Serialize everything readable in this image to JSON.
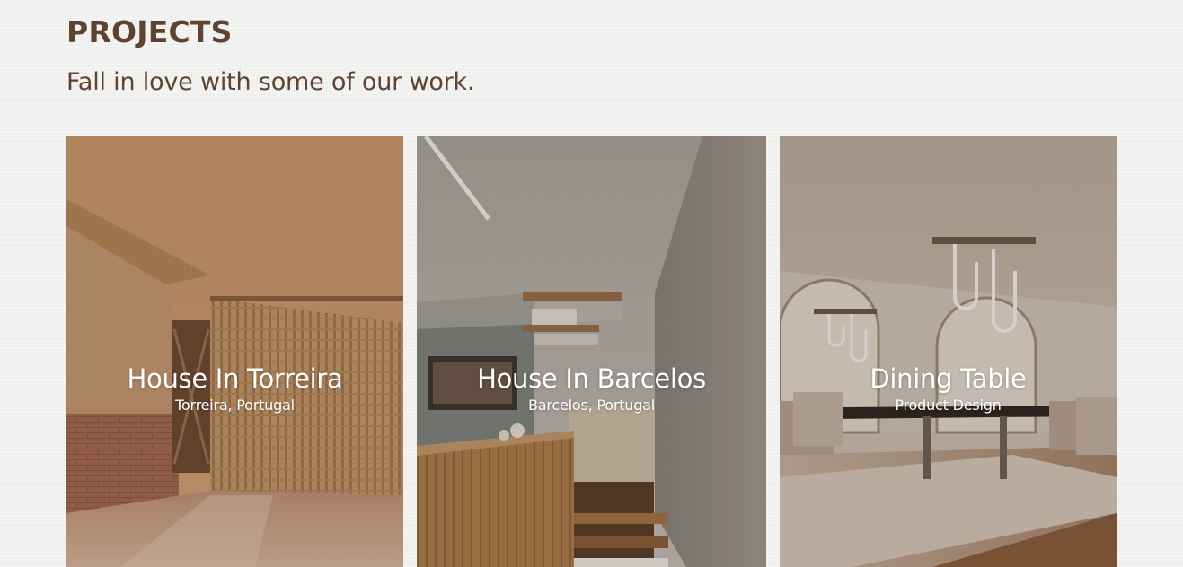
{
  "section": {
    "title": "PROJECTS",
    "subtitle": "Fall in love with some of our work."
  },
  "projects": [
    {
      "title": "House In Torreira",
      "subtitle": "Torreira, Portugal"
    },
    {
      "title": "House In Barcelos",
      "subtitle": "Barcelos, Portugal"
    },
    {
      "title": "Dining Table",
      "subtitle": "Product Design"
    }
  ],
  "colors": {
    "heading": "#5d4332",
    "background": "#f1f1ef",
    "caption_text": "#ffffff"
  }
}
